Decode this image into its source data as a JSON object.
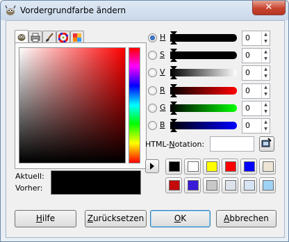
{
  "window": {
    "title": "Vordergrundfarbe ändern",
    "close_glyph": "✕"
  },
  "tabs": [
    {
      "icon": "gimp-wilber-icon",
      "active": true
    },
    {
      "icon": "printer-icon",
      "active": false
    },
    {
      "icon": "paintbrush-icon",
      "active": false
    },
    {
      "icon": "color-wheel-icon",
      "active": false
    },
    {
      "icon": "color-palette-icon",
      "active": false
    }
  ],
  "preview": {
    "current_label": "Aktuell:",
    "previous_label": "Vorher:",
    "current_color": "#000000"
  },
  "channels": [
    {
      "key": "H",
      "rest": "",
      "value": "0",
      "selected": true,
      "gradient": [
        "#000000",
        "#000000"
      ]
    },
    {
      "key": "S",
      "rest": "",
      "value": "0",
      "selected": false,
      "gradient": [
        "#000000",
        "#000000"
      ]
    },
    {
      "key": "V",
      "rest": "",
      "value": "0",
      "selected": false,
      "gradient": [
        "#000000",
        "#ffffff"
      ]
    },
    {
      "key": "R",
      "rest": "",
      "value": "0",
      "selected": false,
      "gradient": [
        "#000000",
        "#ff0000"
      ]
    },
    {
      "key": "G",
      "rest": "",
      "value": "0",
      "selected": false,
      "gradient": [
        "#000000",
        "#00ff00"
      ]
    },
    {
      "key": "B",
      "rest": "",
      "value": "0",
      "selected": false,
      "gradient": [
        "#000000",
        "#0000ff"
      ]
    }
  ],
  "html_notation": {
    "label_prefix": "HTML-",
    "label_mnemonic": "N",
    "label_rest": "otation:",
    "value": ""
  },
  "history": [
    [
      "#000000",
      "#ffffff",
      "#ffff00",
      "#ff0000",
      "#0000ff",
      "#ede4d4"
    ],
    [
      "#c40a0a",
      "#3a1ad6",
      "#c8c8c8",
      "#dbe2ea",
      "#d6e4f4",
      "#9fd2f4"
    ]
  ],
  "buttons": {
    "help": {
      "mnemonic": "H",
      "rest": "ilfe"
    },
    "reset": {
      "mnemonic": "Z",
      "rest": "urücksetzen"
    },
    "ok": {
      "mnemonic": "O",
      "rest": "K"
    },
    "cancel": {
      "mnemonic": "A",
      "rest": "bbrechen"
    }
  }
}
